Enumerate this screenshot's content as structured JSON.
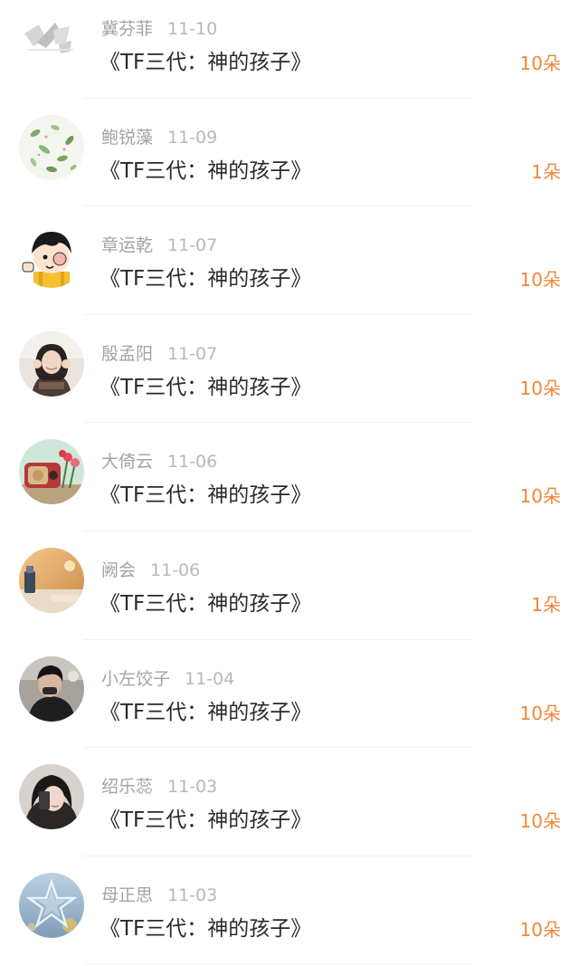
{
  "gift_list": {
    "items": [
      {
        "user": "冀芬菲",
        "date": "11-10",
        "title": "《TF三代：神的孩子》",
        "gift": "10朵",
        "avatar": "logo-avatar-icon"
      },
      {
        "user": "鲍锐藻",
        "date": "11-09",
        "title": "《TF三代：神的孩子》",
        "gift": "1朵",
        "avatar": "leaves-avatar-icon"
      },
      {
        "user": "章运乾",
        "date": "11-07",
        "title": "《TF三代：神的孩子》",
        "gift": "10朵",
        "avatar": "cartoon-girl-avatar-icon"
      },
      {
        "user": "殷孟阳",
        "date": "11-07",
        "title": "《TF三代：神的孩子》",
        "gift": "10朵",
        "avatar": "girl-photo-avatar-icon"
      },
      {
        "user": "大倚云",
        "date": "11-06",
        "title": "《TF三代：神的孩子》",
        "gift": "10朵",
        "avatar": "radio-flowers-avatar-icon"
      },
      {
        "user": "阙会",
        "date": "11-06",
        "title": "《TF三代：神的孩子》",
        "gift": "1朵",
        "avatar": "cafe-drink-avatar-icon"
      },
      {
        "user": "小左饺子",
        "date": "11-04",
        "title": "《TF三代：神的孩子》",
        "gift": "10朵",
        "avatar": "boy-photo-avatar-icon"
      },
      {
        "user": "绍乐蕊",
        "date": "11-03",
        "title": "《TF三代：神的孩子》",
        "gift": "10朵",
        "avatar": "selfie-girl-avatar-icon"
      },
      {
        "user": "母正思",
        "date": "11-03",
        "title": "《TF三代：神的孩子》",
        "gift": "10朵",
        "avatar": "star-ornament-avatar-icon"
      }
    ]
  },
  "colors": {
    "gift_accent": "#ef8838",
    "title_text": "#2a2a2a",
    "meta_text": "#a3a3a3",
    "divider": "#f2f2f2"
  }
}
